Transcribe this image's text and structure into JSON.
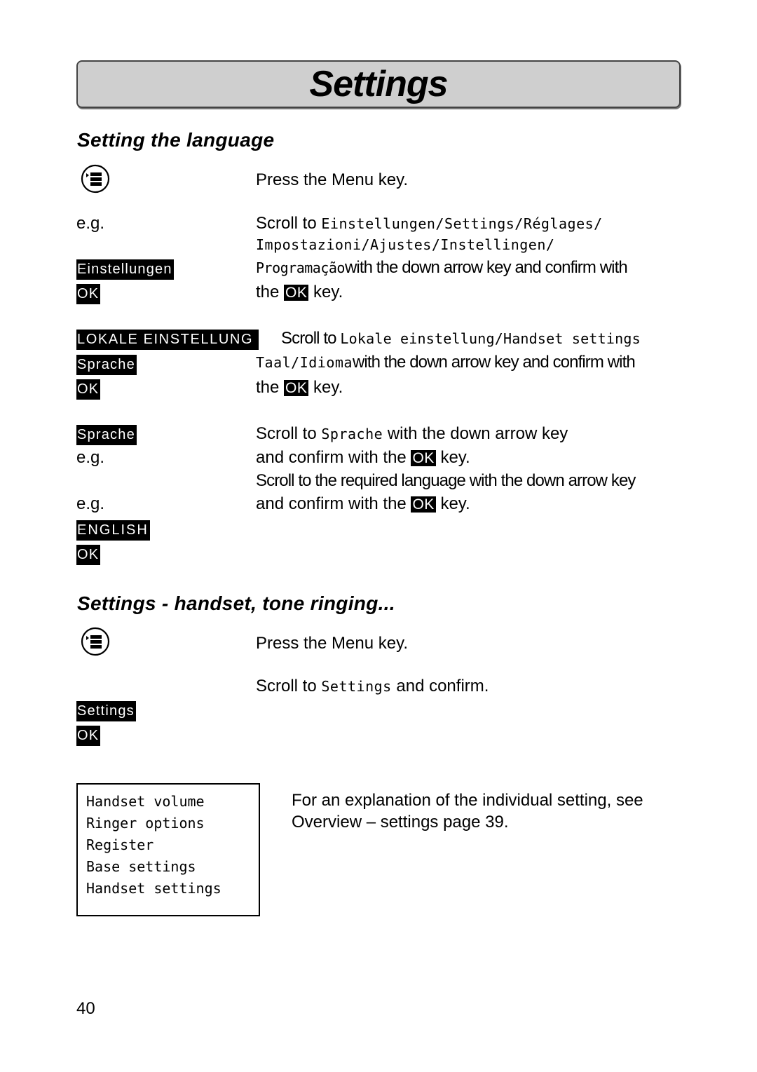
{
  "page": {
    "title": "Settings",
    "page_number": "40"
  },
  "section1": {
    "heading": "Setting the language",
    "menu_icon": "menu-key-icon",
    "step1": "Press the Menu key.",
    "eg": "e.g.",
    "step2": {
      "prefix": "Scroll to ",
      "lcd_line1": "Einstellungen/Settings/Réglages/",
      "lcd_line2": "Impostazioni/Ajustes/Instellingen/",
      "lcd_line3": "Programação",
      "suffix": "with the down arrow key and confirm with",
      "line4_pre": "the ",
      "ok": "OK",
      "line4_post": " key.",
      "display": [
        "Einstellungen",
        "OK"
      ]
    },
    "step3": {
      "display_head": "LOKALE EINSTELLUNG",
      "prefix": "Scroll to ",
      "lcd_line1": "Lokale einstellung/Handset settings",
      "lcd_line2": "Taal/Idioma",
      "suffix": "with the down arrow key and confirm with",
      "line3_pre": "the ",
      "ok": "OK",
      "line3_post": " key.",
      "display": [
        "Sprache",
        "OK"
      ]
    },
    "step4": {
      "display": "Sprache",
      "prefix": "Scroll to ",
      "lcd": "Sprache",
      "suffix": " with the down arrow key",
      "line2_pre": "and confirm with the ",
      "ok": "OK",
      "line2_post": " key.",
      "line3": "Scroll to the required language with the down arrow key",
      "line4_pre": "and confirm with the ",
      "line4_post": " key.",
      "eg1": "e.g.",
      "eg2": "e.g.",
      "display_lang": "ENGLISH",
      "display_ok": "OK"
    }
  },
  "section2": {
    "heading": "Settings - handset, tone ringing...",
    "menu_icon": "menu-key-icon",
    "step1": "Press the Menu key.",
    "step2_prefix": "Scroll to ",
    "step2_lcd": "Settings",
    "step2_suffix": " and confirm.",
    "display": [
      "Settings",
      "OK"
    ],
    "screen_items": [
      "Handset volume",
      "Ringer options",
      "Register",
      "Base settings",
      "Handset settings"
    ],
    "note_line1": "For an explanation of the individual setting, see",
    "note_line2": "Overview – settings page 39."
  }
}
